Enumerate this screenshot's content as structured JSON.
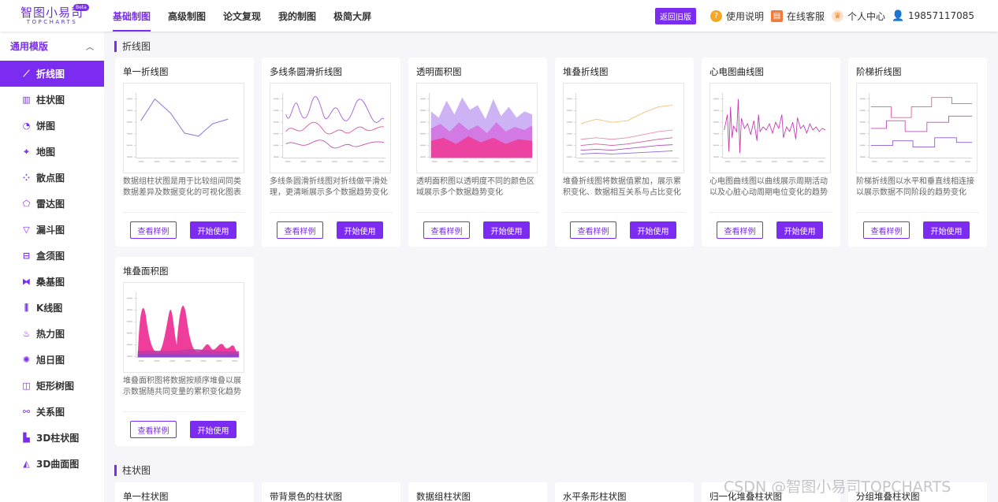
{
  "logo": {
    "main": "智图小易司",
    "sub": "TOPCHARTS",
    "badge": "Beta"
  },
  "main_nav": [
    {
      "label": "基础制图",
      "active": true
    },
    {
      "label": "高级制图"
    },
    {
      "label": "论文复现"
    },
    {
      "label": "我的制图"
    },
    {
      "label": "极简大屏"
    }
  ],
  "right_nav": {
    "old_version": "返回旧版",
    "help": "使用说明",
    "service": "在线客服",
    "personal": "个人中心",
    "phone": "19857117085"
  },
  "sidebar": {
    "heading": "通用模版",
    "items": [
      {
        "label": "折线图",
        "icon": "line-chart-icon",
        "glyph": "⟋",
        "active": true
      },
      {
        "label": "柱状图",
        "icon": "bar-chart-icon",
        "glyph": "▥"
      },
      {
        "label": "饼图",
        "icon": "pie-chart-icon",
        "glyph": "◔"
      },
      {
        "label": "地图",
        "icon": "map-pin-icon",
        "glyph": "⌖"
      },
      {
        "label": "散点图",
        "icon": "scatter-icon",
        "glyph": "⁘"
      },
      {
        "label": "雷达图",
        "icon": "radar-icon",
        "glyph": "⬠"
      },
      {
        "label": "漏斗图",
        "icon": "funnel-icon",
        "glyph": "▽"
      },
      {
        "label": "盒须图",
        "icon": "boxplot-icon",
        "glyph": "⊟"
      },
      {
        "label": "桑基图",
        "icon": "sankey-icon",
        "glyph": "⧓"
      },
      {
        "label": "K线图",
        "icon": "candlestick-icon",
        "glyph": "⫼"
      },
      {
        "label": "热力图",
        "icon": "heatmap-icon",
        "glyph": "♨"
      },
      {
        "label": "旭日图",
        "icon": "sunburst-icon",
        "glyph": "✺"
      },
      {
        "label": "矩形树图",
        "icon": "treemap-icon",
        "glyph": "◫"
      },
      {
        "label": "关系图",
        "icon": "graph-icon",
        "glyph": "⚯"
      },
      {
        "label": "3D柱状图",
        "icon": "bar-3d-icon",
        "glyph": "▙"
      },
      {
        "label": "3D曲面图",
        "icon": "surface-3d-icon",
        "glyph": "◭"
      }
    ]
  },
  "sections": {
    "line": {
      "title": "折线图"
    },
    "bar": {
      "title": "柱状图"
    }
  },
  "cards": [
    {
      "title": "单一折线图",
      "desc": "数据组柱状图是用于比较组间同类数据差异及数据变化的可视化图表",
      "thumb": "simple-line"
    },
    {
      "title": "多线条圆滑折线图",
      "desc": "多线条圆滑折线图对折线做平滑处理，更清晰展示多个数据趋势变化",
      "thumb": "smooth-lines"
    },
    {
      "title": "透明面积图",
      "desc": "透明面积图以透明度不同的颜色区域展示多个数据趋势变化",
      "thumb": "transparent-area"
    },
    {
      "title": "堆叠折线图",
      "desc": "堆叠折线图将数据值累加，展示累积变化、数据相互关系与占比变化",
      "thumb": "stacked-line"
    },
    {
      "title": "心电图曲线图",
      "desc": "心电图曲线图以曲线展示周期活动以及心脏心动周期电位变化的趋势",
      "thumb": "ecg"
    },
    {
      "title": "阶梯折线图",
      "desc": "阶梯折线图以水平和垂直线相连接以展示数据不同阶段的趋势变化",
      "thumb": "step-line"
    },
    {
      "title": "堆叠面积图",
      "desc": "堆叠面积图将数据按顺序堆叠以展示数据随共同变量的累积变化趋势",
      "thumb": "stacked-area"
    }
  ],
  "card_buttons": {
    "example": "查看样例",
    "start": "开始使用"
  },
  "bar_cards": [
    {
      "title": "单一柱状图"
    },
    {
      "title": "带背景色的柱状图"
    },
    {
      "title": "数据组柱状图"
    },
    {
      "title": "水平条形柱状图"
    },
    {
      "title": "归一化堆叠柱状图"
    },
    {
      "title": "分组堆叠柱状图"
    }
  ],
  "watermark": "CSDN @智图小易司TOPCHARTS",
  "colors": {
    "accent": "#7b2cf0",
    "pink": "#ee3d9a",
    "lavender": "#c6a6f2"
  }
}
